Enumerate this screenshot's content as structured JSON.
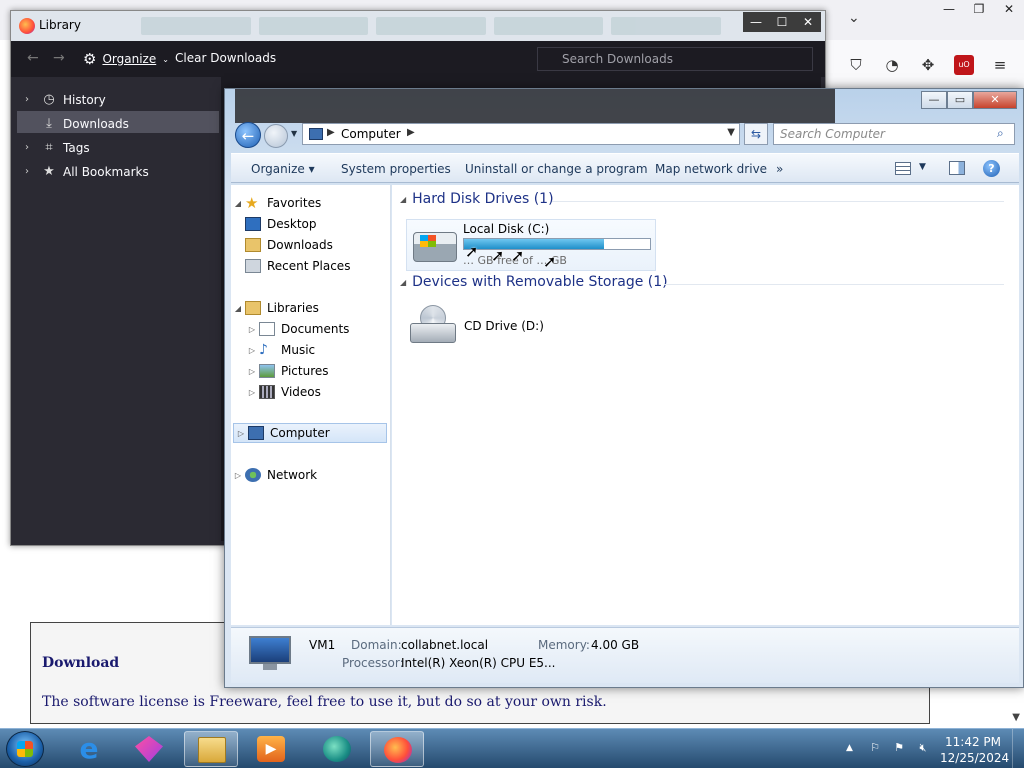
{
  "library": {
    "title": "Library",
    "toolbar": {
      "organize_label": "Organize",
      "clear_downloads_label": "Clear Downloads",
      "search_placeholder": "Search Downloads"
    },
    "sidebar": [
      {
        "label": "History",
        "icon": "clock-icon",
        "expandable": true,
        "selected": false
      },
      {
        "label": "Downloads",
        "icon": "download-icon",
        "expandable": false,
        "selected": true
      },
      {
        "label": "Tags",
        "icon": "tag-icon",
        "expandable": true,
        "selected": false
      },
      {
        "label": "All Bookmarks",
        "icon": "star-icon",
        "expandable": true,
        "selected": false
      }
    ]
  },
  "explorer": {
    "address": {
      "location": "Computer"
    },
    "search_placeholder": "Search Computer",
    "command_bar": {
      "organize": "Organize",
      "system_properties": "System properties",
      "uninstall": "Uninstall or change a program",
      "map_drive": "Map network drive",
      "more": "»"
    },
    "nav": {
      "favorites": "Favorites",
      "desktop": "Desktop",
      "downloads": "Downloads",
      "recent_places": "Recent Places",
      "libraries": "Libraries",
      "documents": "Documents",
      "music": "Music",
      "pictures": "Pictures",
      "videos": "Videos",
      "computer": "Computer",
      "network": "Network"
    },
    "groups": {
      "hard_disks": "Hard Disk Drives (1)",
      "removable": "Devices with Removable Storage (1)"
    },
    "drive_c": {
      "label": "Local Disk (C:)",
      "space_text": "… GB free of … GB",
      "used_fraction": 0.75
    },
    "drive_d": {
      "label": "CD Drive (D:)"
    },
    "details": {
      "name": "VM1",
      "domain_label": "Domain:",
      "domain_value": "collabnet.local",
      "memory_label": "Memory:",
      "memory_value": "4.00 GB",
      "processor_label": "Processor:",
      "processor_value": "Intel(R) Xeon(R) CPU E5..."
    }
  },
  "background_page": {
    "download_heading": "Download",
    "license_text": "The software license is Freeware, feel free to use it, but do so at your own risk."
  },
  "taskbar": {
    "apps": [
      {
        "name": "internet-explorer",
        "active": false
      },
      {
        "name": "paint-3d-like",
        "active": false
      },
      {
        "name": "file-explorer",
        "active": true
      },
      {
        "name": "media-player",
        "active": false
      },
      {
        "name": "edge-like",
        "active": false
      },
      {
        "name": "firefox",
        "active": true
      }
    ],
    "clock": {
      "time": "11:42 PM",
      "date": "12/25/2024"
    }
  },
  "colors": {
    "library_bg": "#2b2a33",
    "library_selected": "#52525e",
    "explorer_heading": "#1e3287",
    "drive_fill": "#1f8fc9"
  }
}
